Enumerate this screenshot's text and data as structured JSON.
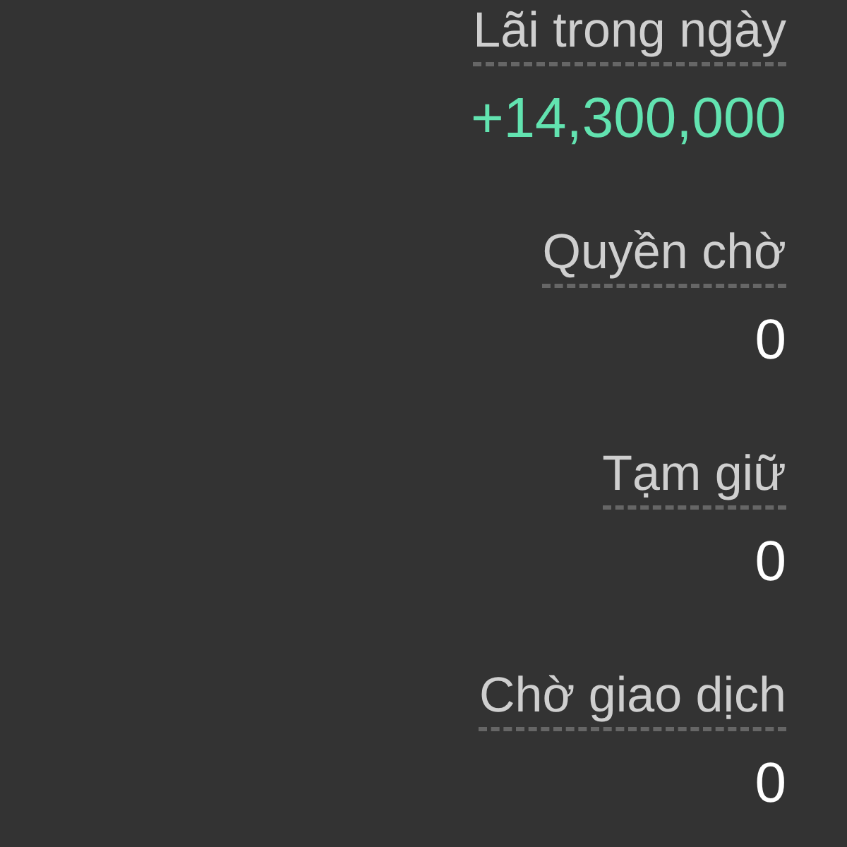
{
  "items": [
    {
      "label": "Lãi trong ngày",
      "value": "+14,300,000",
      "color": "#62e3b0"
    },
    {
      "label": "Quyền chờ",
      "value": "0",
      "color": "#ffffff"
    },
    {
      "label": "Tạm giữ",
      "value": "0",
      "color": "#ffffff"
    },
    {
      "label": "Chờ giao dịch",
      "value": "0",
      "color": "#ffffff"
    }
  ]
}
